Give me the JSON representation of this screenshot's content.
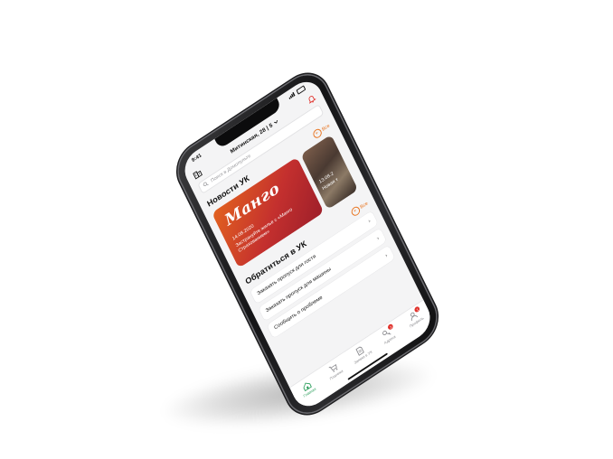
{
  "status": {
    "time": "9:41"
  },
  "header": {
    "address": "Митинская, 28 | 5",
    "building_icon": "building-icon",
    "bell_icon": "bell-icon"
  },
  "search": {
    "placeholder": "Поиск в Домопульте"
  },
  "news": {
    "title": "Новости УК",
    "all_label": "Все",
    "cards": [
      {
        "logo": "Манго",
        "date": "14.08.2020",
        "text": "Застрахуйте жилье с «Манго Страхованием»"
      },
      {
        "date": "13.08.2",
        "text": "Новая т"
      }
    ]
  },
  "uk": {
    "title": "Обратиться в УК",
    "all_label": "Все",
    "items": [
      {
        "label": "Заказать пропуск для гостя"
      },
      {
        "label": "Заказать пропуск для машины"
      },
      {
        "label": "Сообщить о проблеме"
      }
    ]
  },
  "tabbar": {
    "tabs": [
      {
        "label": "Главная",
        "icon": "home-icon",
        "active": true
      },
      {
        "label": "Платежи",
        "icon": "cart-icon"
      },
      {
        "label": "Заявки в УК",
        "icon": "document-icon"
      },
      {
        "label": "Адреса",
        "icon": "key-icon",
        "badge": "2"
      },
      {
        "label": "Профиль",
        "icon": "user-icon",
        "badge": "1"
      }
    ]
  },
  "colors": {
    "accent": "#e8721c",
    "active_tab": "#2a9d5a",
    "badge": "#e0322c"
  }
}
